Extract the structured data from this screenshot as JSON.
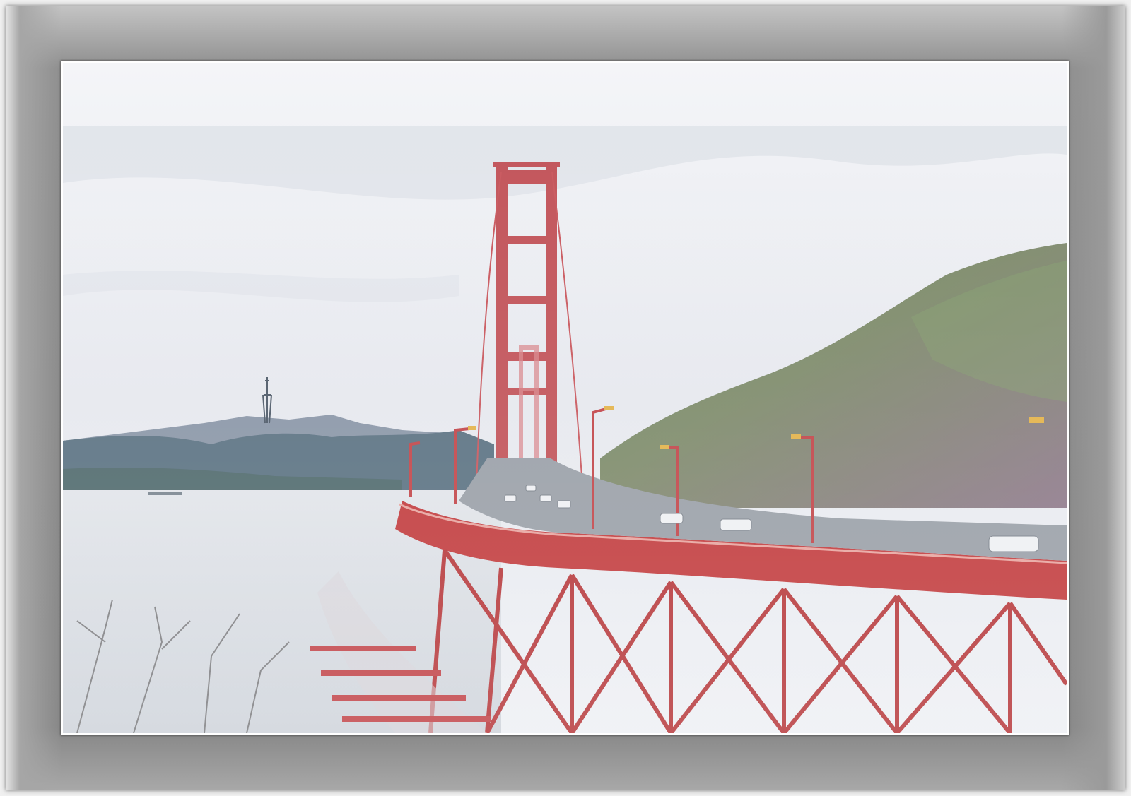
{
  "image": {
    "subject": "",
    "colors": {
      "sky": "#eceef3",
      "bridge_red": "#c0393b",
      "tower_red": "#c2545a",
      "water": "#d9dde3",
      "hill_green": "#6f8a5e",
      "hill_purple": "#8e7f8c",
      "distant_hills": "#5f7384",
      "frame_gray": "#8c8c8c",
      "mat_white": "#ffffff"
    }
  }
}
